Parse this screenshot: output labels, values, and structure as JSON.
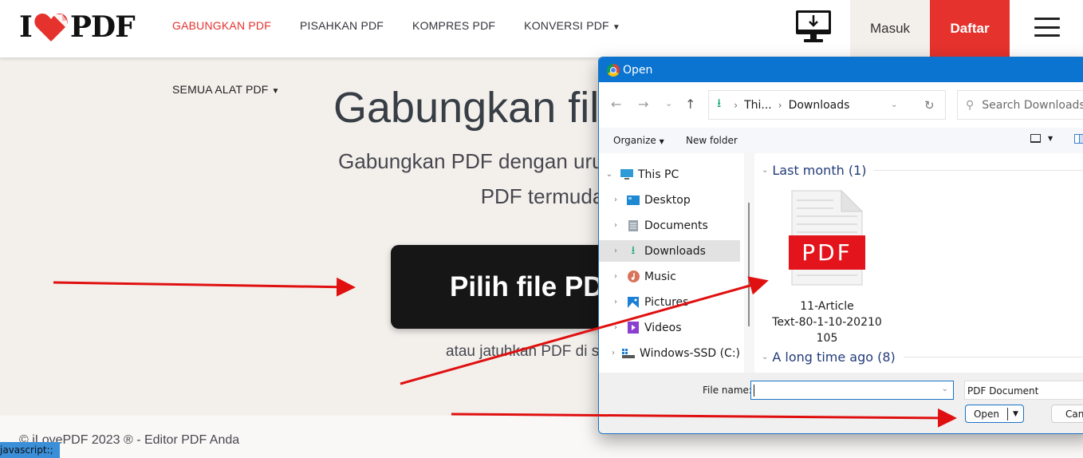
{
  "header": {
    "logo": {
      "left": "I",
      "right": "PDF"
    },
    "nav": [
      {
        "label": "GABUNGKAN PDF",
        "active": true
      },
      {
        "label": "PISAHKAN PDF",
        "active": false
      },
      {
        "label": "KOMPRES PDF",
        "active": false
      },
      {
        "label": "KONVERSI PDF",
        "active": false,
        "dropdown": true
      }
    ],
    "desktop_icon": "desktop-download-icon",
    "login_label": "Masuk",
    "signup_label": "Daftar",
    "menu_icon": "hamburger-menu-icon"
  },
  "main": {
    "all_tools_label": "SEMUA ALAT PDF",
    "title": "Gabungkan file PDF",
    "subtitle_line1": "Gabungkan PDF dengan urutan yang Anda i",
    "subtitle_line2": "PDF termuda",
    "select_button": "Pilih file PDF",
    "drop_text": "atau jatuhkan PDF di sini"
  },
  "footer": {
    "copyright": "© iLovePDF 2023 ® - Editor PDF Anda",
    "status_tooltip": "javascript:;"
  },
  "dialog": {
    "title": "Open",
    "nav": {
      "back": "←",
      "forward": "→",
      "recent": "⌄",
      "up": "↑"
    },
    "address": {
      "crumbs": [
        "Thi...",
        "Downloads"
      ]
    },
    "search_placeholder": "Search Downloads",
    "commands": {
      "organize": "Organize",
      "new_folder": "New folder"
    },
    "tree": [
      {
        "label": "This PC",
        "icon": "this-pc-icon",
        "expanded": true,
        "level": 0
      },
      {
        "label": "Desktop",
        "icon": "desktop-folder-icon",
        "level": 1
      },
      {
        "label": "Documents",
        "icon": "documents-folder-icon",
        "level": 1
      },
      {
        "label": "Downloads",
        "icon": "downloads-folder-icon",
        "level": 1,
        "selected": true
      },
      {
        "label": "Music",
        "icon": "music-folder-icon",
        "level": 1
      },
      {
        "label": "Pictures",
        "icon": "pictures-folder-icon",
        "level": 1
      },
      {
        "label": "Videos",
        "icon": "videos-folder-icon",
        "level": 1
      },
      {
        "label": "Windows-SSD (C:)",
        "icon": "drive-icon",
        "level": 1
      }
    ],
    "groups": [
      {
        "label": "Last month (1)"
      },
      {
        "label": "A long time ago (8)"
      }
    ],
    "files": [
      {
        "name_lines": [
          "11-Article",
          "Text-80-1-10-20210",
          "105"
        ],
        "type_badge": "PDF"
      }
    ],
    "file_name_label": "File name:",
    "file_name_value": "",
    "file_type_filter": "PDF Document",
    "open_label": "Open",
    "cancel_label": "Cancel"
  },
  "colors": {
    "brand_red": "#e5322d",
    "dialog_blue": "#0a74d0",
    "page_bg": "#f3f0ec",
    "annotation_red": "#e01010"
  }
}
